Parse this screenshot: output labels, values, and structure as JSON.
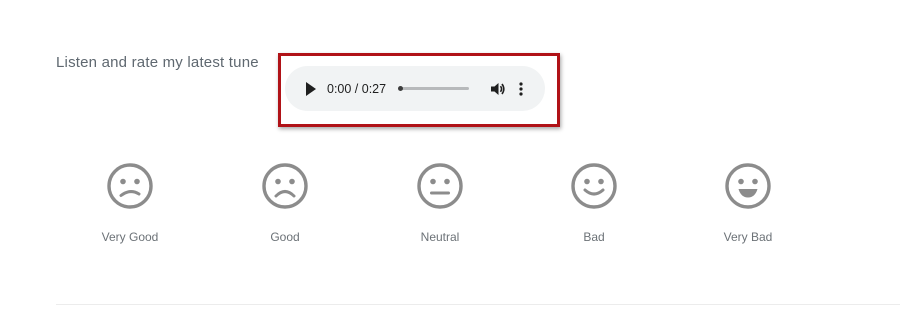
{
  "question": {
    "label": "Listen and rate my latest tune"
  },
  "audio_player": {
    "time_display": "0:00 / 0:27",
    "progress": 0.0,
    "icons": [
      "play-icon",
      "volume-icon",
      "more-options-icon"
    ]
  },
  "rating": {
    "options": [
      {
        "label": "Very Good",
        "face": "sad-face-icon"
      },
      {
        "label": "Good",
        "face": "frown-face-icon"
      },
      {
        "label": "Neutral",
        "face": "neutral-face-icon"
      },
      {
        "label": "Bad",
        "face": "smile-face-icon"
      },
      {
        "label": "Very Bad",
        "face": "grin-face-icon"
      }
    ]
  },
  "colors": {
    "highlight_border": "#b01217",
    "face_stroke": "#8c8c8c",
    "player_bg": "#f1f3f4",
    "label_text": "#6c7277"
  }
}
